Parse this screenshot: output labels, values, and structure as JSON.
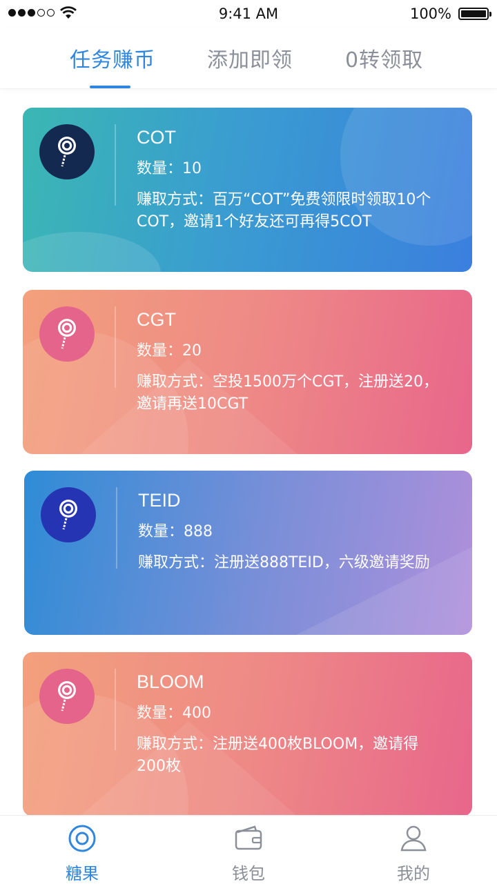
{
  "status_bar": {
    "time": "9:41 AM",
    "battery": "100%"
  },
  "tabs": [
    {
      "label": "任务赚币",
      "active": true
    },
    {
      "label": "添加即领",
      "active": false
    },
    {
      "label": "0转领取",
      "active": false
    }
  ],
  "cards": [
    {
      "title": "COT",
      "amount": "数量：10",
      "desc": "赚取方式：百万“COT”免费领限时领取10个COT，邀请1个好友还可再得5COT",
      "icon": "lollipop-icon"
    },
    {
      "title": "CGT",
      "amount": "数量：20",
      "desc": "赚取方式：空投1500万个CGT，注册送20，邀请再送10CGT",
      "icon": "lollipop-icon"
    },
    {
      "title": "TEID",
      "amount": "数量：888",
      "desc": "赚取方式：注册送888TEID，六级邀请奖励",
      "icon": "lollipop-icon"
    },
    {
      "title": "BLOOM",
      "amount": "数量：400",
      "desc": "赚取方式：注册送400枚BLOOM，邀请得200枚",
      "icon": "lollipop-icon"
    }
  ],
  "bottom_nav": [
    {
      "label": "糖果",
      "icon": "candy-target-icon",
      "active": true
    },
    {
      "label": "钱包",
      "icon": "wallet-icon",
      "active": false
    },
    {
      "label": "我的",
      "icon": "user-icon",
      "active": false
    }
  ],
  "colors": {
    "accent": "#2e86de",
    "inactive": "#8a8f98"
  }
}
